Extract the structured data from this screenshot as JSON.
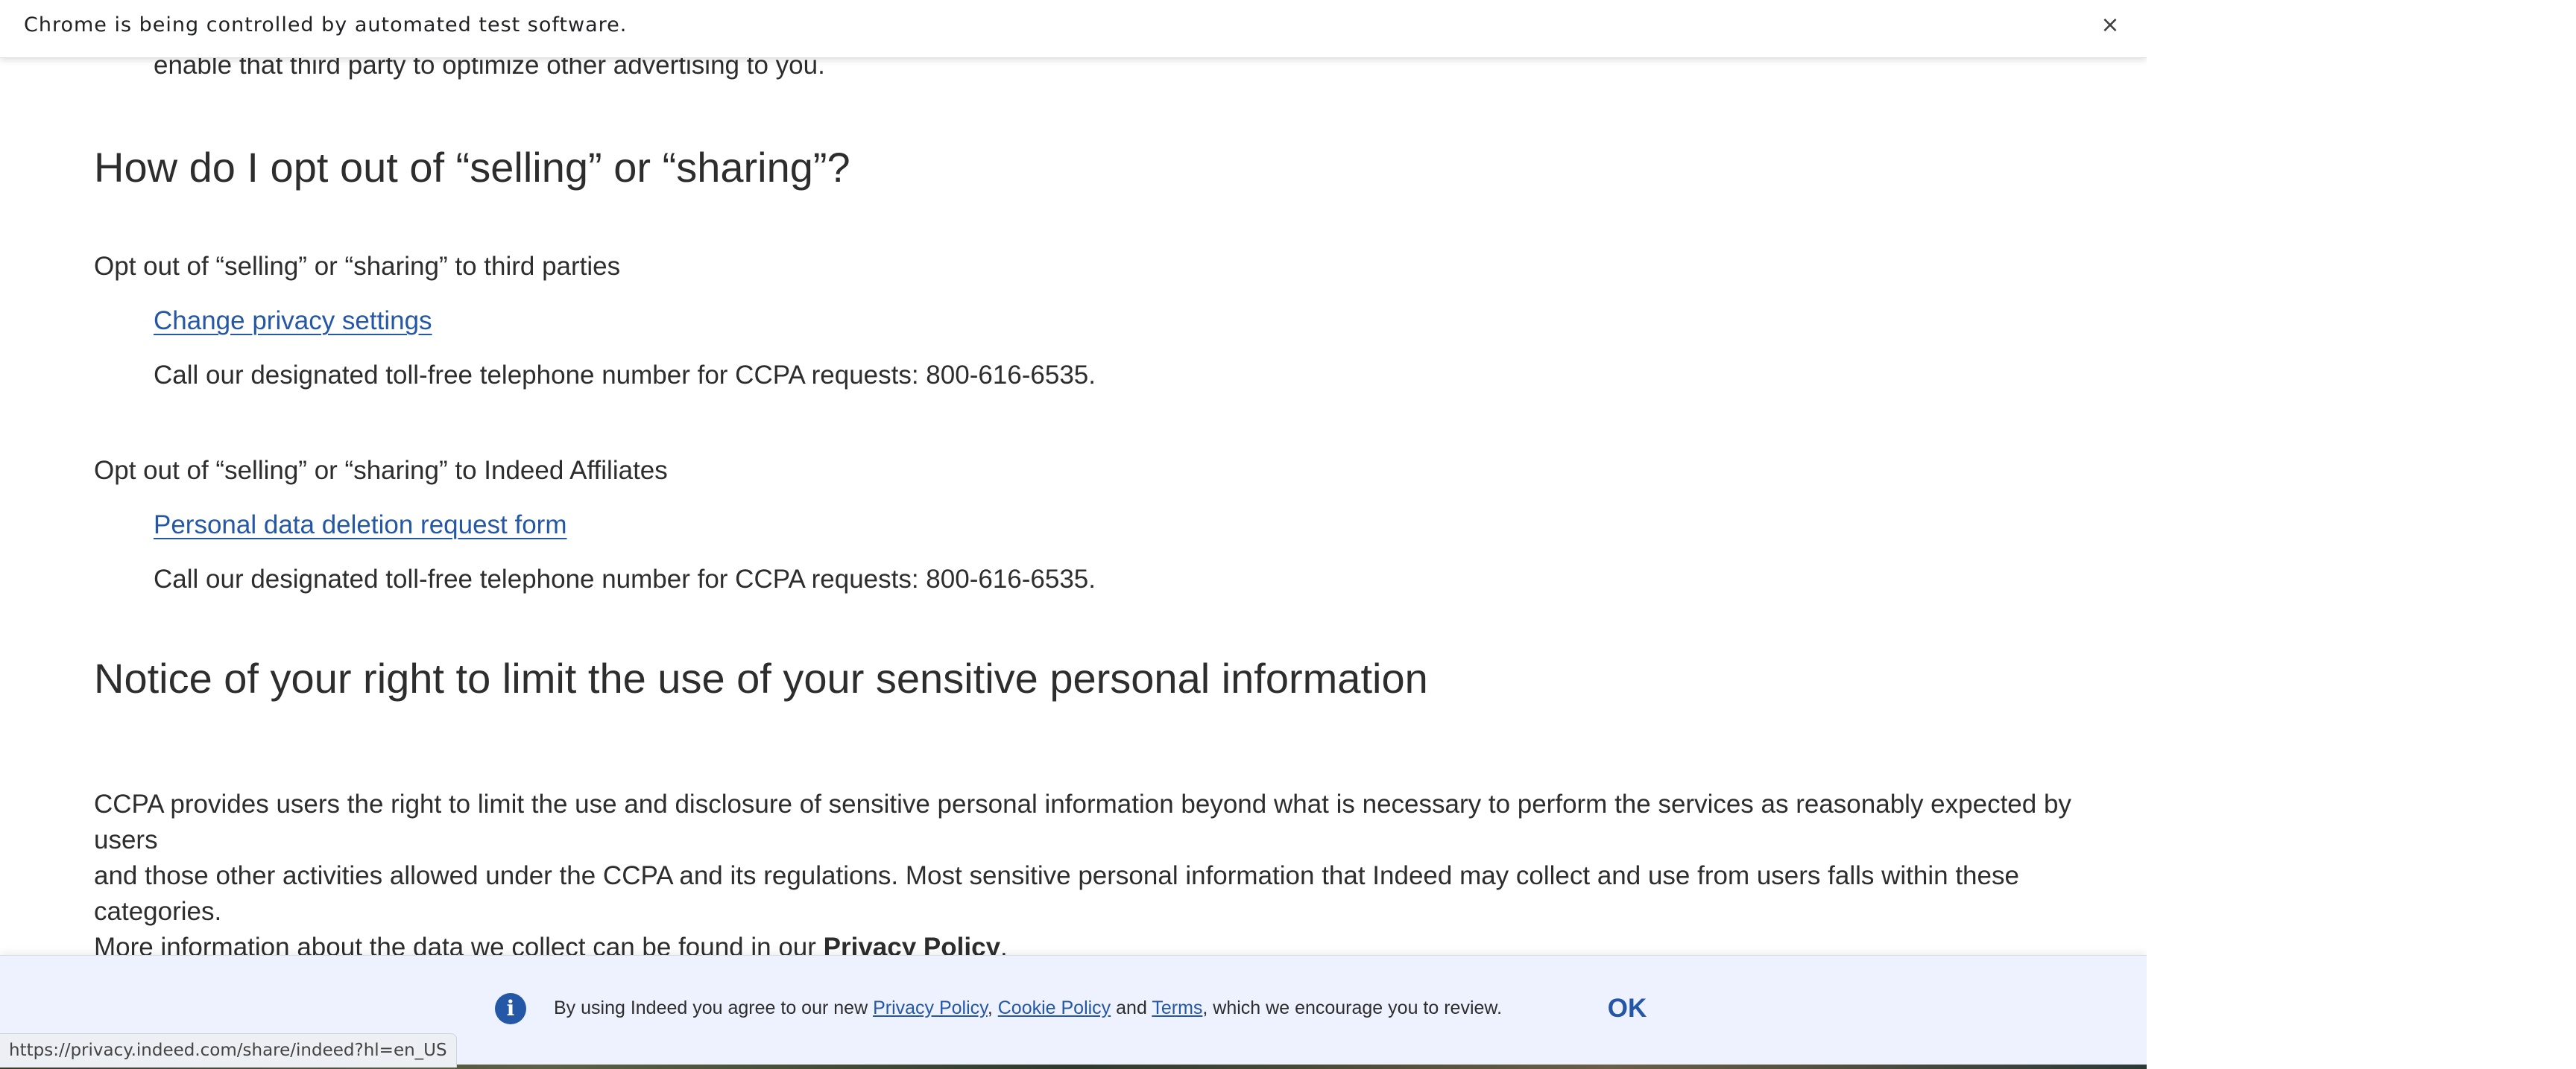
{
  "browser": {
    "infobar_text": "Chrome is being controlled by automated test software.",
    "close_glyph": "×",
    "status_url": "https://privacy.indeed.com/share/indeed?hl=en_US"
  },
  "content": {
    "carry_line": "enable that third party to optimize other advertising to you.",
    "opt_out_heading": "How do I opt out of “selling” or “sharing”?",
    "third_parties": {
      "heading": "Opt out of “selling” or “sharing” to third parties",
      "link": "Change privacy settings",
      "phone": "Call our designated toll-free telephone number for CCPA requests: 800-616-6535."
    },
    "affiliates": {
      "heading": "Opt out of “selling” or “sharing” to Indeed Affiliates",
      "link": "Personal data deletion request form",
      "phone": "Call our designated toll-free telephone number for CCPA requests: 800-616-6535."
    },
    "notice_heading": "Notice of your right to limit the use of your sensitive personal information",
    "paragraph_line1": "CCPA provides users the right to limit the use and disclosure of sensitive personal information beyond what is necessary to perform the services as reasonably expected by users",
    "paragraph_line2": "and those other activities allowed under the CCPA and its regulations. Most sensitive personal information that Indeed may collect and use from users falls within these categories.",
    "paragraph_line3_prefix": "More information about the data we collect can be found in our ",
    "paragraph_link": "Privacy Policy",
    "paragraph_suffix": "."
  },
  "banner": {
    "info_icon": "i",
    "text_prefix": "By using Indeed you agree to our new ",
    "privacy_link": "Privacy Policy",
    "comma": ", ",
    "cookie_link": "Cookie Policy",
    "and": " and ",
    "terms_link": "Terms",
    "text_suffix": ", which we encourage you to review.",
    "ok_label": "OK",
    "colors": {
      "accent": "#2557a7",
      "background": "#eef1fe"
    }
  }
}
